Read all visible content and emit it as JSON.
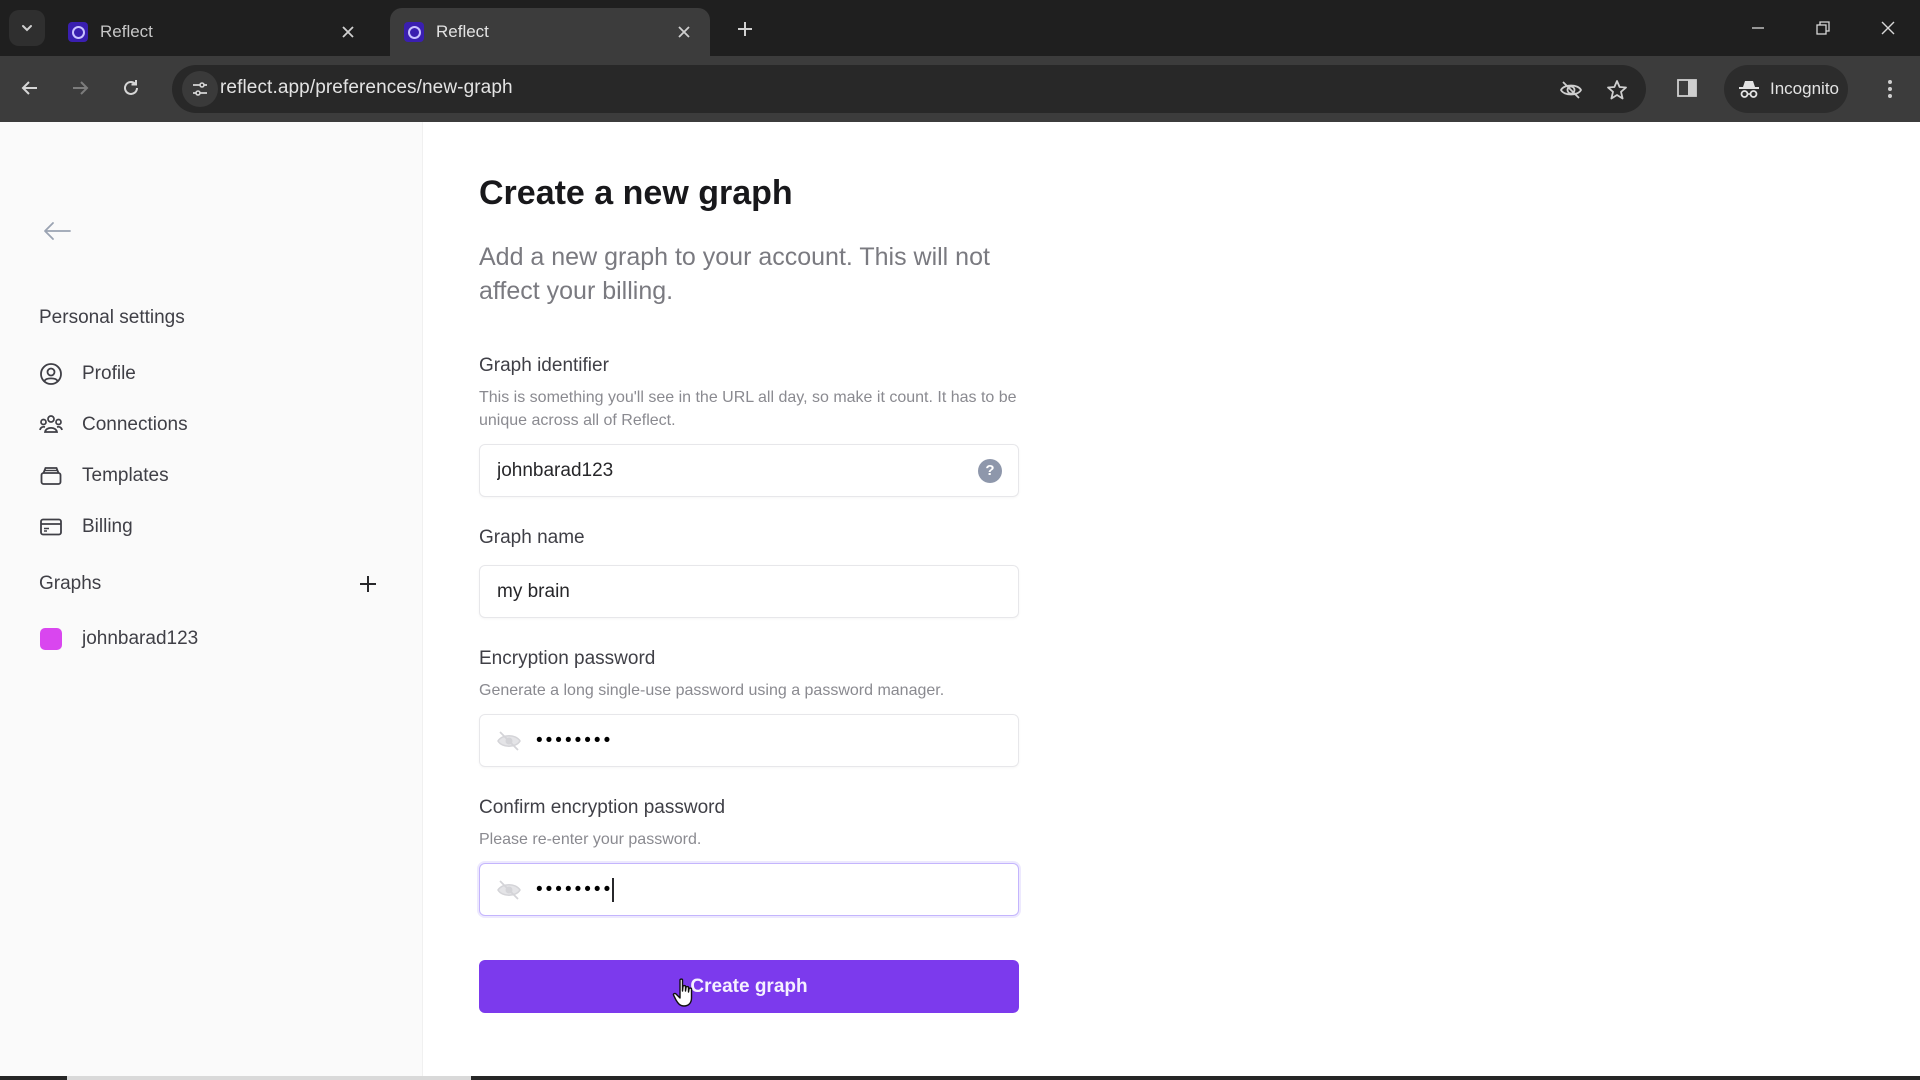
{
  "browser": {
    "tabs": [
      {
        "title": "Reflect",
        "active": false
      },
      {
        "title": "Reflect",
        "active": true
      }
    ],
    "new_tab_label": "+",
    "url": "reflect.app/preferences/new-graph",
    "incognito_label": "Incognito",
    "icons": {
      "tab_search": "chevron-down-icon",
      "back": "arrow-left-icon",
      "forward": "arrow-right-icon",
      "reload": "reload-icon",
      "site_info": "tune-icon",
      "tracking": "eye-off-icon",
      "bookmark": "star-icon",
      "side_panel": "side-panel-icon",
      "incognito": "incognito-icon",
      "menu": "kebab-menu-icon"
    }
  },
  "sidebar": {
    "personal_title": "Personal settings",
    "items": [
      {
        "label": "Profile",
        "icon": "user-circle-icon"
      },
      {
        "label": "Connections",
        "icon": "users-icon"
      },
      {
        "label": "Templates",
        "icon": "template-icon"
      },
      {
        "label": "Billing",
        "icon": "credit-card-icon"
      }
    ],
    "graphs_title": "Graphs",
    "add_graph_icon": "plus-icon",
    "graphs": [
      {
        "label": "johnbarad123",
        "color": "#d946ef"
      }
    ]
  },
  "form": {
    "title": "Create a new graph",
    "subtitle": "Add a new graph to your account. This will not affect your billing.",
    "identifier": {
      "label": "Graph identifier",
      "help": "This is something you'll see in the URL all day, so make it count. It has to be unique across all of Reflect.",
      "value": "johnbarad123",
      "help_icon": "?"
    },
    "name": {
      "label": "Graph name",
      "value": "my brain"
    },
    "password": {
      "label": "Encryption password",
      "help": "Generate a long single-use password using a password manager.",
      "value": "••••••••"
    },
    "confirm_password": {
      "label": "Confirm encryption password",
      "help": "Please re-enter your password.",
      "value": "••••••••"
    },
    "submit_label": "Create graph"
  },
  "colors": {
    "accent": "#7c3aed",
    "graph_swatch": "#d946ef"
  }
}
